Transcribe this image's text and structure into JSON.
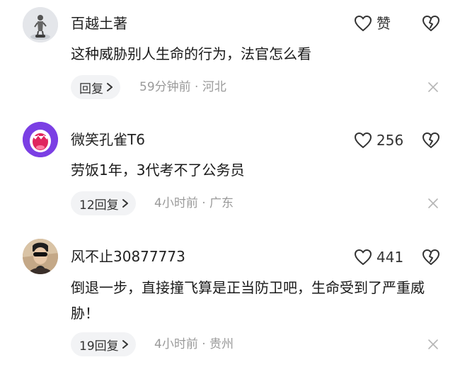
{
  "comments": [
    {
      "avatar_icon": "figure-avatar",
      "username": "百越土著",
      "like_label": "赞",
      "text": "这种威胁别人生命的行为，法官怎么看",
      "reply_label": "回复",
      "time": "59分钟前",
      "location": "河北",
      "meta": "59分钟前 · 河北"
    },
    {
      "avatar_icon": "screaming-mouth-avatar",
      "username": "微笑孔雀T6",
      "like_label": "256",
      "text": "劳饭1年，3代考不了公务员",
      "reply_label": "12回复",
      "time": "4小时前",
      "location": "广东",
      "meta": "4小时前 · 广东"
    },
    {
      "avatar_icon": "sunglasses-person-avatar",
      "username": "风不止30877773",
      "like_label": "441",
      "text": "倒退一步，直接撞飞算是正当防卫吧，生命受到了严重威胁！",
      "reply_label": "19回复",
      "time": "4小时前",
      "location": "贵州",
      "meta": "4小时前 · 贵州"
    }
  ],
  "icons": {
    "like": "heart-outline-icon",
    "dislike": "broken-heart-icon",
    "reply_arrow": "chevron-right-icon",
    "dismiss": "close-icon"
  },
  "colors": {
    "text": "#1a1a1a",
    "meta": "#9a9a9a",
    "reply_bg": "#f2f3f5",
    "avatar2_bg": "#7b3fe4"
  }
}
